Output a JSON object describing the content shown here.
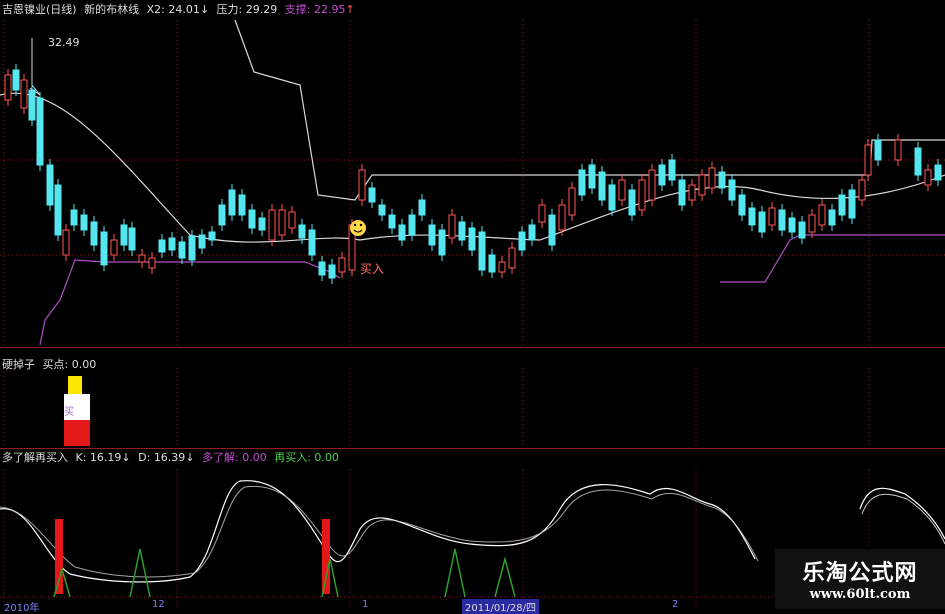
{
  "main_header": {
    "name": "吉恩镍业(日线)",
    "indicator": "新的布林线",
    "x2": "X2: 24.01",
    "x2_arrow": "↓",
    "pressure": "压力: 29.29",
    "support": "支撑: 22.95",
    "support_arrow": "↑"
  },
  "main_chart": {
    "high_label": "32.49",
    "buy_label": "买入"
  },
  "mid_header": {
    "name": "硬掉子",
    "buy_point": "买点: 0.00"
  },
  "mid_chart": {
    "bar_text": "买"
  },
  "kd_header": {
    "name": "多了解再买入",
    "k": "K: 16.19",
    "k_arrow": "↓",
    "d": "D: 16.39",
    "d_arrow": "↓",
    "more": "多了解: 0.00",
    "rebuy": "再买入: 0.00"
  },
  "bottom_axis": {
    "left_date": "2010年",
    "date": "2011/01/28/四",
    "m12": "12",
    "m1": "1",
    "m2": "2"
  },
  "watermark": {
    "title": "乐淘公式网",
    "url": "www.60lt.com"
  },
  "colors": {
    "up": "#ff5555",
    "down": "#55e6f0",
    "support_line": "#b04fc8",
    "pressure_line": "#d8d8d8",
    "grid": "#8b1e1e",
    "kd_k": "#ffffff",
    "kd_d": "#cccccc",
    "signal_green": "#2e9e2e",
    "signal_red": "#e31818",
    "yellow": "#ffe600"
  },
  "icons": {
    "smiley": "smiley-icon"
  }
}
